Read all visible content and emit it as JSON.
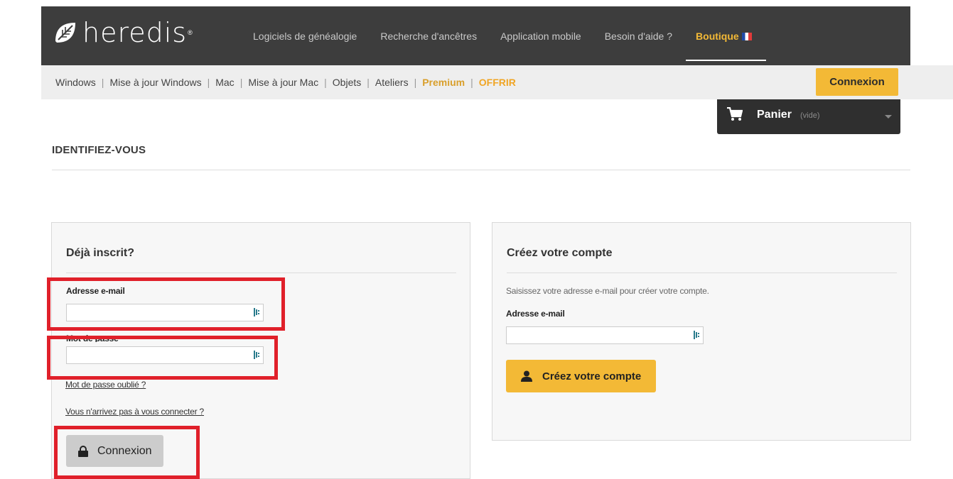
{
  "header": {
    "logo_text": "heredis",
    "logo_mark": "®",
    "nav": [
      {
        "label": "Logiciels de généalogie"
      },
      {
        "label": "Recherche d'ancêtres"
      },
      {
        "label": "Application mobile"
      },
      {
        "label": "Besoin d'aide ?"
      },
      {
        "label": "Boutique"
      }
    ],
    "accent_color": "#f3b936",
    "background_color": "#3d3d3d"
  },
  "subnav": {
    "items": [
      {
        "label": "Windows"
      },
      {
        "label": "Mise à jour Windows"
      },
      {
        "label": "Mac"
      },
      {
        "label": "Mise à jour Mac"
      },
      {
        "label": "Objets"
      },
      {
        "label": "Ateliers"
      },
      {
        "label": "Premium"
      },
      {
        "label": "OFFRIR"
      }
    ],
    "separator": "|",
    "login_label": "Connexion"
  },
  "cart": {
    "label": "Panier",
    "state": "(vide)"
  },
  "page": {
    "title": "IDENTIFIEZ-VOUS"
  },
  "login": {
    "title": "Déjà inscrit?",
    "email_label": "Adresse e-mail",
    "email_value": "",
    "password_label": "Mot de passe",
    "password_value": "",
    "forgot_link": "Mot de passe oublié ?",
    "trouble_link": "Vous n'arrivez pas à vous connecter ?",
    "submit_label": "Connexion"
  },
  "register": {
    "title": "Créez votre compte",
    "hint": "Saisissez votre adresse e-mail pour créer votre compte.",
    "email_label": "Adresse e-mail",
    "email_value": "",
    "submit_label": "Créez votre compte"
  },
  "highlight_color": "#e0202a"
}
